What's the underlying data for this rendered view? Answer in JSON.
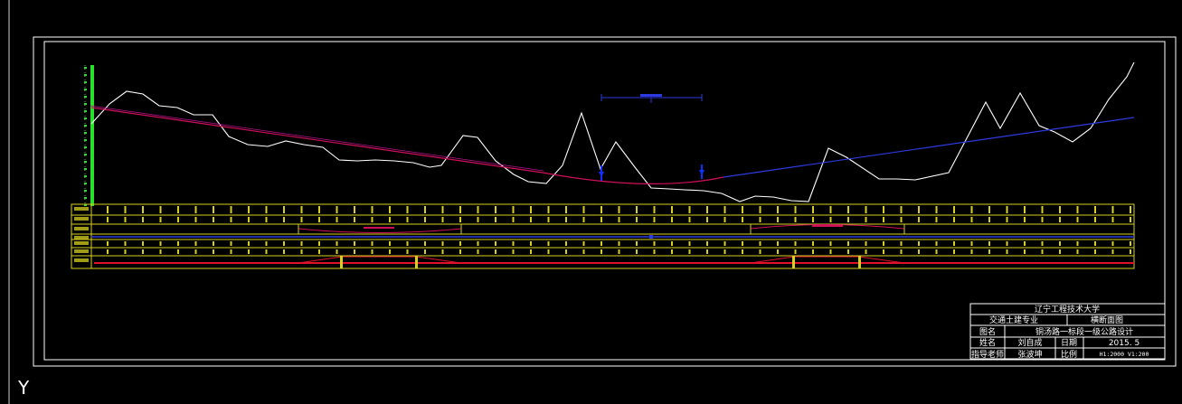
{
  "colors": {
    "background": "#000000",
    "frame": "#ffffff",
    "ground_line": "#ffffff",
    "grade_line_west": "#d0105a",
    "grade_line_east": "#2d3adf",
    "vertical_scale": "#29e02a",
    "data_table": "#d6d020",
    "curve_line": "#e0102a",
    "marker": "#1030ff"
  },
  "title_block": {
    "university": "辽宁工程技术大学",
    "major": "交通土建专业",
    "drawing_type": "横断面图",
    "drawing_name_label": "图名",
    "drawing_name": "铜汤路一标段一级公路设计",
    "name_label": "姓名",
    "name": "刘自成",
    "date_label": "日期",
    "date": "2015. 5",
    "advisor_label": "指导老师",
    "advisor": "张波坤",
    "scale_label": "比例",
    "scale": "H1:2000  V1:200"
  },
  "ucs_label": "Y"
}
